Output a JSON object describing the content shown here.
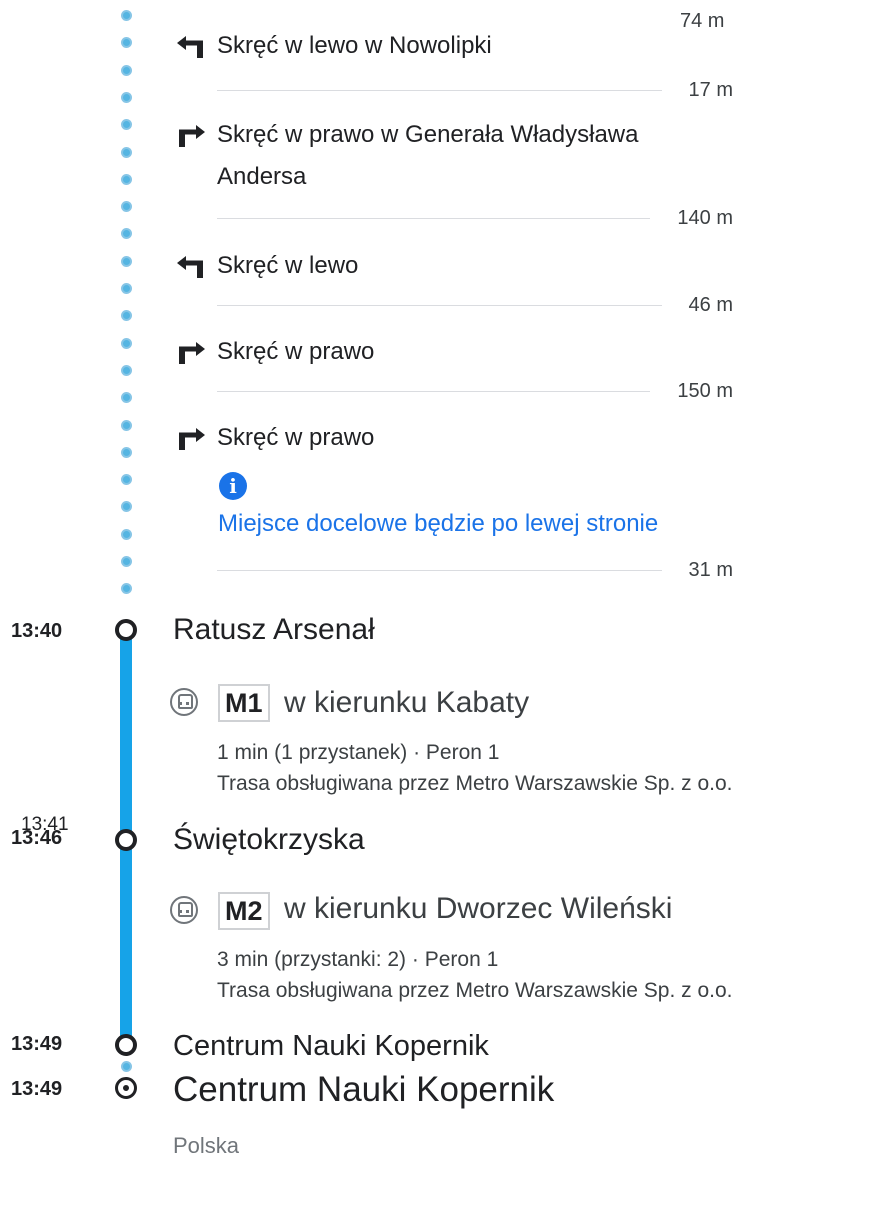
{
  "walking": {
    "steps": [
      {
        "instruction": "Skręć w lewo w Nowolipki",
        "direction": "left",
        "distance": "17 m"
      },
      {
        "instruction_line1": "Skręć w prawo w Generała Władysława",
        "instruction_line2": "Andersa",
        "direction": "right",
        "distance": "140 m"
      },
      {
        "instruction": "Skręć w lewo",
        "direction": "left",
        "distance": "46 m"
      },
      {
        "instruction": "Skręć w prawo",
        "direction": "right",
        "distance": "150 m"
      },
      {
        "instruction": "Skręć w prawo",
        "direction": "right",
        "distance": "31 m"
      }
    ],
    "top_distance": "74 m",
    "note": "Miejsce docelowe będzie po lewej stronie"
  },
  "stops": [
    {
      "time": "13:40",
      "name": "Ratusz Arsenał"
    },
    {
      "planned_time": "13:41",
      "time": "13:46",
      "name": "Świętokrzyska"
    },
    {
      "time": "13:49",
      "name": "Centrum Nauki Kopernik"
    }
  ],
  "legs": [
    {
      "line": "M1",
      "direction": "w kierunku Kabaty",
      "duration": "1 min (1 przystanek) · Peron 1",
      "operator": "Trasa obsługiwana przez Metro Warszawskie Sp. z o.o."
    },
    {
      "line": "M2",
      "direction": "w kierunku Dworzec Wileński",
      "duration": "3 min (przystanki: 2) · Peron 1",
      "operator": "Trasa obsługiwana przez Metro Warszawskie Sp. z o.o."
    }
  ],
  "destination": {
    "time": "13:49",
    "name": "Centrum Nauki Kopernik",
    "country": "Polska"
  },
  "colors": {
    "metro": "#16a3e8",
    "walk_dot": "#2ea7de",
    "link": "#1a73e8"
  },
  "icons": {
    "left": "turn-left-icon",
    "right": "turn-right-icon",
    "info": "info-icon",
    "transit": "subway-icon",
    "stop": "stop-circle-icon",
    "destination": "destination-pin-icon"
  }
}
